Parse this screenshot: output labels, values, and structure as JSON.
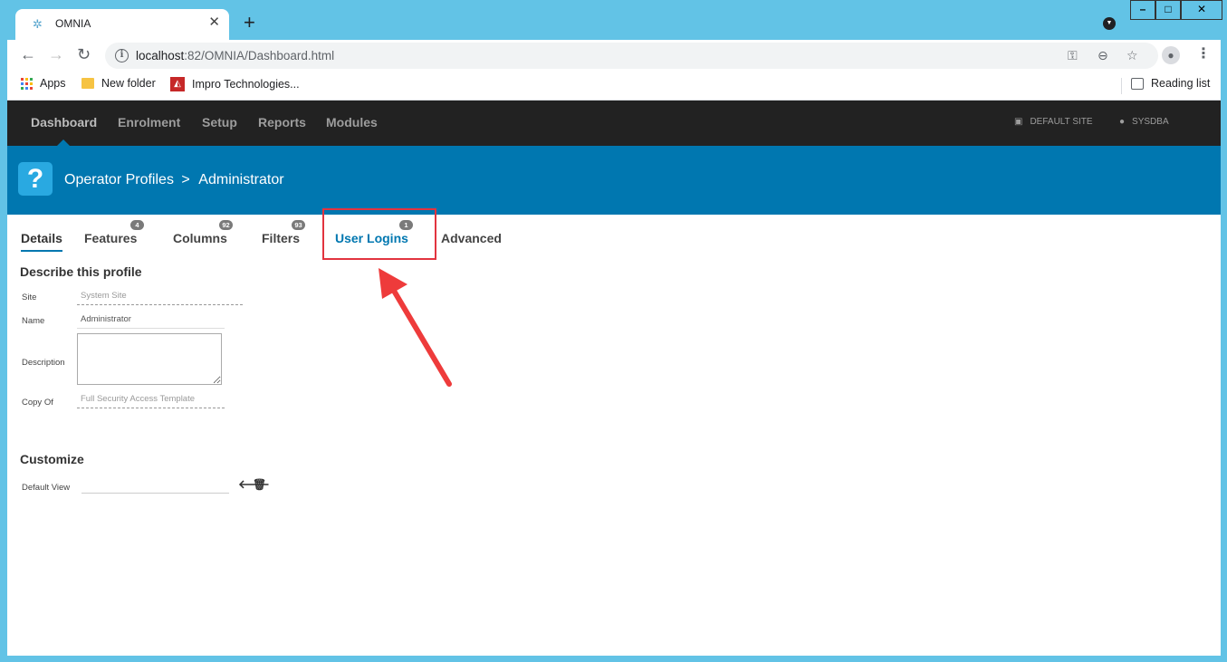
{
  "browser": {
    "tab_title": "OMNIA",
    "tab_close": "✕",
    "new_tab": "+",
    "url_host": "localhost",
    "url_path": ":82/OMNIA/Dashboard.html",
    "bookmarks": [
      {
        "label": "Apps",
        "icon": "apps-grid-icon"
      },
      {
        "label": "New folder",
        "icon": "folder-icon"
      },
      {
        "label": "Impro Technologies...",
        "icon": "impro-icon"
      }
    ],
    "reading_list": "Reading list",
    "window_controls": {
      "minimize": "–",
      "maximize": "□",
      "close": "✕"
    }
  },
  "app_nav": {
    "items": [
      "Dashboard",
      "Enrolment",
      "Setup",
      "Reports",
      "Modules"
    ],
    "active": "Dashboard",
    "site": "DEFAULT SITE",
    "user": "SYSDBA"
  },
  "header": {
    "icon": "?",
    "breadcrumb_parent": "Operator Profiles",
    "breadcrumb_sep": ">",
    "breadcrumb_current": "Administrator"
  },
  "tabs": [
    {
      "label": "Details",
      "badge": null,
      "active": true
    },
    {
      "label": "Features",
      "badge": "4"
    },
    {
      "label": "Columns",
      "badge": "92"
    },
    {
      "label": "Filters",
      "badge": "93"
    },
    {
      "label": "User Logins",
      "badge": "1",
      "highlighted": true
    },
    {
      "label": "Advanced",
      "badge": null
    }
  ],
  "describe": {
    "title": "Describe this profile",
    "site_label": "Site",
    "site_value": "System Site",
    "name_label": "Name",
    "name_value": "Administrator",
    "description_label": "Description",
    "description_value": "",
    "copyof_label": "Copy Of",
    "copyof_value": "Full Security Access Template"
  },
  "customize": {
    "title": "Customize",
    "default_view_label": "Default View",
    "default_view_value": ""
  },
  "colors": {
    "nav_bg": "#222222",
    "band_bg": "#0077b0",
    "highlight_box": "#e2343f",
    "annotation_arrow": "#ee3b3b",
    "accent": "#29a9e1"
  }
}
